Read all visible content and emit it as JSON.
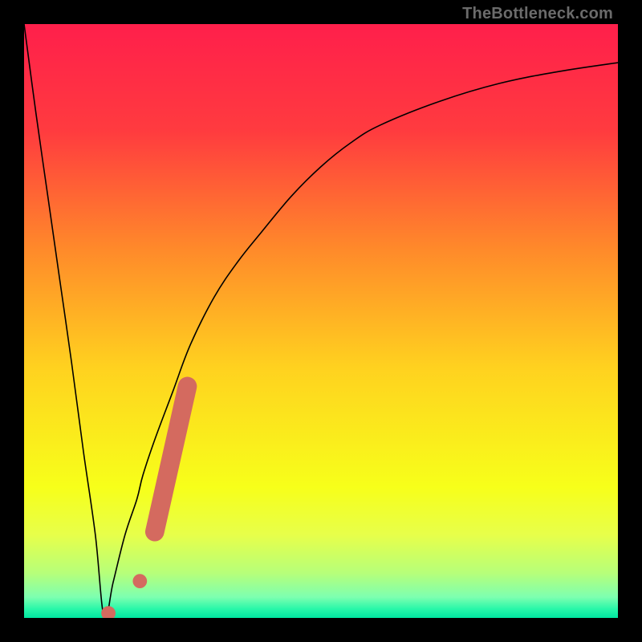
{
  "watermark": "TheBottleneck.com",
  "chart_data": {
    "type": "line",
    "title": "",
    "xlabel": "",
    "ylabel": "",
    "xlim": [
      0,
      100
    ],
    "ylim": [
      0,
      100
    ],
    "grid": false,
    "series": [
      {
        "name": "bottleneck-curve",
        "x": [
          0,
          2,
          4,
          6,
          8,
          10,
          12,
          13.5,
          15,
          17,
          19,
          20,
          22,
          25,
          28,
          32,
          36,
          40,
          45,
          50,
          55,
          60,
          70,
          80,
          90,
          100
        ],
        "y": [
          100,
          85,
          71,
          57,
          43,
          28,
          14,
          0,
          6,
          14,
          20,
          24,
          30,
          38,
          46,
          54,
          60,
          65,
          71,
          76,
          80,
          83,
          87,
          90,
          92,
          93.5
        ]
      }
    ],
    "markers": [
      {
        "name": "highlight-marker-a",
        "x": 14.2,
        "y": 0.8,
        "r": 1.2,
        "color": "#d46a5f"
      },
      {
        "name": "highlight-marker-b",
        "x": 19.5,
        "y": 6.2,
        "r": 1.2,
        "color": "#d46a5f"
      },
      {
        "name": "highlight-bar",
        "x1": 22.0,
        "y1": 14.5,
        "x2": 27.5,
        "y2": 39.0,
        "width": 3.2,
        "color": "#d46a5f"
      }
    ],
    "background_gradient": {
      "stops": [
        {
          "offset": 0.0,
          "color": "#ff1f4b"
        },
        {
          "offset": 0.18,
          "color": "#ff3b3f"
        },
        {
          "offset": 0.38,
          "color": "#ff8a2a"
        },
        {
          "offset": 0.58,
          "color": "#ffd21f"
        },
        {
          "offset": 0.78,
          "color": "#f7ff1a"
        },
        {
          "offset": 0.86,
          "color": "#e7ff4a"
        },
        {
          "offset": 0.925,
          "color": "#b6ff7a"
        },
        {
          "offset": 0.965,
          "color": "#7dffb0"
        },
        {
          "offset": 0.985,
          "color": "#28f7a9"
        },
        {
          "offset": 1.0,
          "color": "#00e6a0"
        }
      ]
    }
  }
}
